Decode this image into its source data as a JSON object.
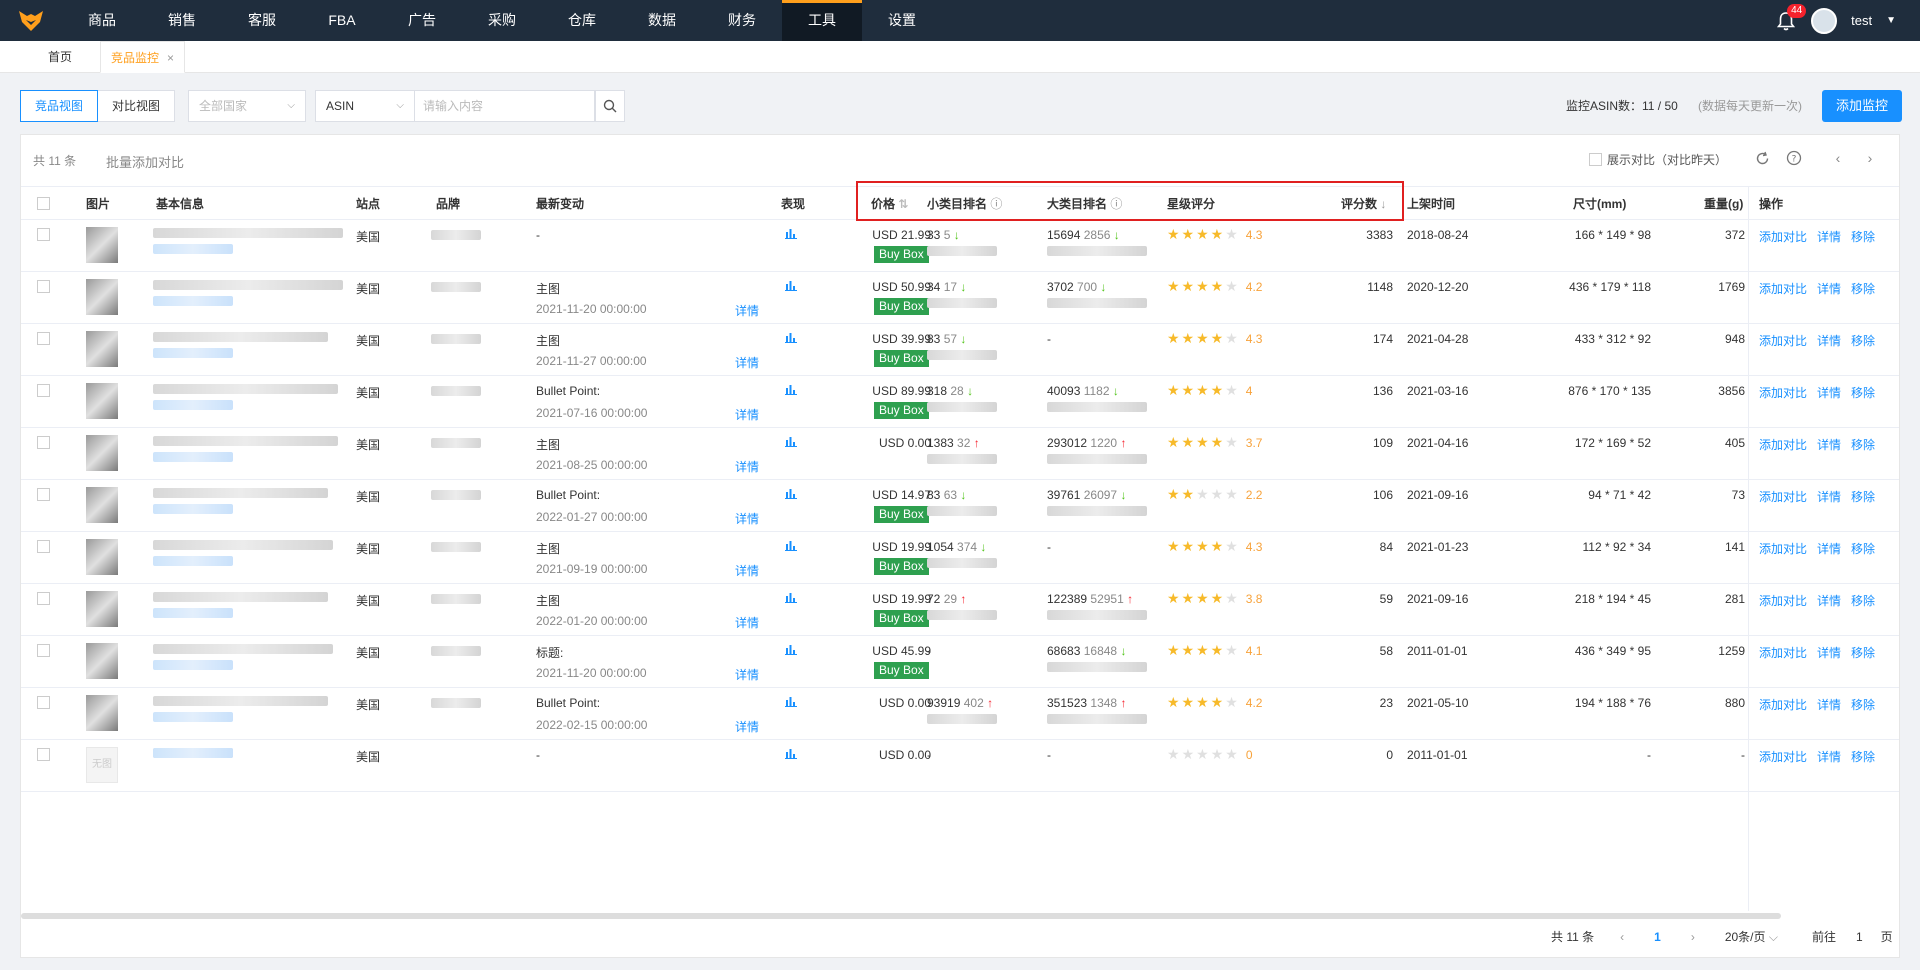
{
  "nav": {
    "items": [
      "商品",
      "销售",
      "客服",
      "FBA",
      "广告",
      "采购",
      "仓库",
      "数据",
      "财务",
      "工具",
      "设置"
    ],
    "active": "工具",
    "badge": "44",
    "user": "test"
  },
  "tabs": {
    "home": "首页",
    "monitor": "竞品监控",
    "close": "×"
  },
  "toolbar": {
    "view_product": "竞品视图",
    "view_compare": "对比视图",
    "country_placeholder": "全部国家",
    "field_select": "ASIN",
    "search_placeholder": "请输入内容",
    "monitor_count": "监控ASIN数：11 / 50",
    "monitor_note": "(数据每天更新一次)",
    "add_button": "添加监控"
  },
  "panel": {
    "total": "共 11 条",
    "batch_add": "批量添加对比",
    "show_compare": "展示对比（对比昨天）"
  },
  "columns": {
    "image": "图片",
    "info": "基本信息",
    "site": "站点",
    "brand": "品牌",
    "change": "最新变动",
    "perf": "表现",
    "price": "价格",
    "small_rank": "小类目排名",
    "big_rank": "大类目排名",
    "star": "星级评分",
    "reviews": "评分数",
    "listed": "上架时间",
    "size": "尺寸(mm)",
    "weight": "重量(g)",
    "ops": "操作"
  },
  "ops": {
    "add": "添加对比",
    "detail": "详情",
    "remove": "移除",
    "change_detail": "详情",
    "buybox": "Buy Box",
    "no_image": "无图"
  },
  "rows": [
    {
      "site": "美国",
      "change": "-",
      "change_time": "",
      "price": "USD 21.99",
      "buybox": true,
      "srank": "33",
      "sdelta": "5",
      "sdir": "down",
      "brank": "15694",
      "bdelta": "2856",
      "bdir": "down",
      "stars": 4,
      "rating": "4.3",
      "reviews": "3383",
      "listed": "2018-08-24",
      "size": "166 * 149 * 98",
      "weight": "372"
    },
    {
      "site": "美国",
      "change": "主图",
      "change_time": "2021-11-20 00:00:00",
      "price": "USD 50.99",
      "buybox": true,
      "srank": "34",
      "sdelta": "17",
      "sdir": "down",
      "brank": "3702",
      "bdelta": "700",
      "bdir": "down",
      "stars": 4,
      "rating": "4.2",
      "reviews": "1148",
      "listed": "2020-12-20",
      "size": "436 * 179 * 118",
      "weight": "1769"
    },
    {
      "site": "美国",
      "change": "主图",
      "change_time": "2021-11-27 00:00:00",
      "price": "USD 39.99",
      "buybox": true,
      "srank": "83",
      "sdelta": "57",
      "sdir": "down",
      "brank": "-",
      "bdelta": "",
      "bdir": "",
      "stars": 4,
      "rating": "4.3",
      "reviews": "174",
      "listed": "2021-04-28",
      "size": "433 * 312 * 92",
      "weight": "948"
    },
    {
      "site": "美国",
      "change": "Bullet Point:",
      "change_time": "2021-07-16 00:00:00",
      "price": "USD 89.99",
      "buybox": true,
      "srank": "318",
      "sdelta": "28",
      "sdir": "down",
      "brank": "40093",
      "bdelta": "1182",
      "bdir": "down",
      "stars": 4,
      "rating": "4",
      "reviews": "136",
      "listed": "2021-03-16",
      "size": "876 * 170 * 135",
      "weight": "3856"
    },
    {
      "site": "美国",
      "change": "主图",
      "change_time": "2021-08-25 00:00:00",
      "price": "USD 0.00",
      "buybox": false,
      "srank": "1383",
      "sdelta": "32",
      "sdir": "up",
      "brank": "293012",
      "bdelta": "1220",
      "bdir": "up",
      "stars": 4,
      "rating": "3.7",
      "reviews": "109",
      "listed": "2021-04-16",
      "size": "172 * 169 * 52",
      "weight": "405"
    },
    {
      "site": "美国",
      "change": "Bullet Point:",
      "change_time": "2022-01-27 00:00:00",
      "price": "USD 14.97",
      "buybox": true,
      "srank": "83",
      "sdelta": "63",
      "sdir": "down",
      "brank": "39761",
      "bdelta": "26097",
      "bdir": "down",
      "stars": 2,
      "rating": "2.2",
      "reviews": "106",
      "listed": "2021-09-16",
      "size": "94 * 71 * 42",
      "weight": "73"
    },
    {
      "site": "美国",
      "change": "主图",
      "change_time": "2021-09-19 00:00:00",
      "price": "USD 19.99",
      "buybox": true,
      "srank": "1054",
      "sdelta": "374",
      "sdir": "down",
      "brank": "-",
      "bdelta": "",
      "bdir": "",
      "stars": 4,
      "rating": "4.3",
      "reviews": "84",
      "listed": "2021-01-23",
      "size": "112 * 92 * 34",
      "weight": "141"
    },
    {
      "site": "美国",
      "change": "主图",
      "change_time": "2022-01-20 00:00:00",
      "price": "USD 19.99",
      "buybox": true,
      "srank": "72",
      "sdelta": "29",
      "sdir": "up",
      "brank": "122389",
      "bdelta": "52951",
      "bdir": "up",
      "stars": 4,
      "rating": "3.8",
      "reviews": "59",
      "listed": "2021-09-16",
      "size": "218 * 194 * 45",
      "weight": "281"
    },
    {
      "site": "美国",
      "change": "标题:",
      "change_time": "2021-11-20 00:00:00",
      "price": "USD 45.99",
      "buybox": true,
      "srank": "-",
      "sdelta": "",
      "sdir": "",
      "brank": "68683",
      "bdelta": "16848",
      "bdir": "down",
      "stars": 4,
      "rating": "4.1",
      "reviews": "58",
      "listed": "2011-01-01",
      "size": "436 * 349 * 95",
      "weight": "1259"
    },
    {
      "site": "美国",
      "change": "Bullet Point:",
      "change_time": "2022-02-15 00:00:00",
      "price": "USD 0.00",
      "buybox": false,
      "srank": "93919",
      "sdelta": "402",
      "sdir": "up",
      "brank": "351523",
      "bdelta": "1348",
      "bdir": "up",
      "stars": 4,
      "rating": "4.2",
      "reviews": "23",
      "listed": "2021-05-10",
      "size": "194 * 188 * 76",
      "weight": "880"
    },
    {
      "site": "美国",
      "change": "-",
      "change_time": "",
      "price": "USD 0.00",
      "buybox": false,
      "srank": "-",
      "sdelta": "",
      "sdir": "",
      "brank": "-",
      "bdelta": "",
      "bdir": "",
      "stars": 0,
      "rating": "0",
      "reviews": "0",
      "listed": "2011-01-01",
      "size": "-",
      "weight": "-",
      "empty": true
    }
  ],
  "pager": {
    "total": "共 11 条",
    "page": "1",
    "size": "20条/页",
    "goto": "前往",
    "goto_value": "1",
    "unit": "页"
  },
  "colors": {
    "accent": "#1890ff",
    "nav_bg": "#1f2d3d",
    "active_tab": "#ff9f1c",
    "buybox": "#2ea04f",
    "highlight": "#e02020"
  }
}
